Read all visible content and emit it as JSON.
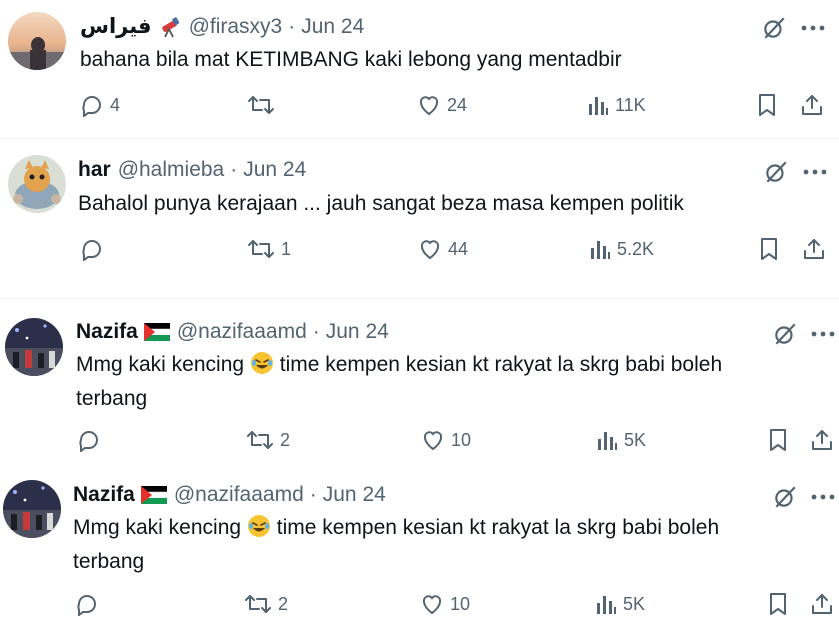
{
  "tweets": [
    {
      "name": "فيراس",
      "handle": "@firasxy3",
      "separator": "·",
      "date": "Jun 24",
      "text": "bahana bila mat KETIMBANG kaki lebong yang mentadbir",
      "text_lines": [
        "bahana bila mat KETIMBANG kaki lebong yang mentadbir"
      ],
      "name_emoji": "telescope-emoji",
      "replies": "4",
      "retweets": "",
      "likes": "24",
      "views": "11K"
    },
    {
      "name": "har",
      "handle": "@halmieba",
      "separator": "·",
      "date": "Jun 24",
      "text_lines": [
        "Bahalol punya kerajaan ... jauh sangat beza masa kempen politik"
      ],
      "replies": "",
      "retweets": "1",
      "likes": "44",
      "views": "5.2K"
    },
    {
      "name": "Nazifa",
      "handle": "@nazifaaamd",
      "separator": "·",
      "date": "Jun 24",
      "name_emoji": "palestine-flag",
      "text_line1_a": "Mmg kaki kencing",
      "text_line1_b": "time kempen kesian kt rakyat la skrg babi boleh",
      "text_line2": "terbang",
      "replies": "",
      "retweets": "2",
      "likes": "10",
      "views": "5K"
    },
    {
      "name": "Nazifa",
      "handle": "@nazifaaamd",
      "separator": "·",
      "date": "Jun 24",
      "name_emoji": "palestine-flag",
      "text_line1_a": "Mmg kaki kencing",
      "text_line1_b": "time kempen kesian kt rakyat la skrg babi boleh",
      "text_line2": "terbang",
      "replies": "",
      "retweets": "2",
      "likes": "10",
      "views": "5K"
    }
  ],
  "colors": {
    "text": "#0f1419",
    "secondary": "#536471",
    "separator": "#eff3f4"
  }
}
